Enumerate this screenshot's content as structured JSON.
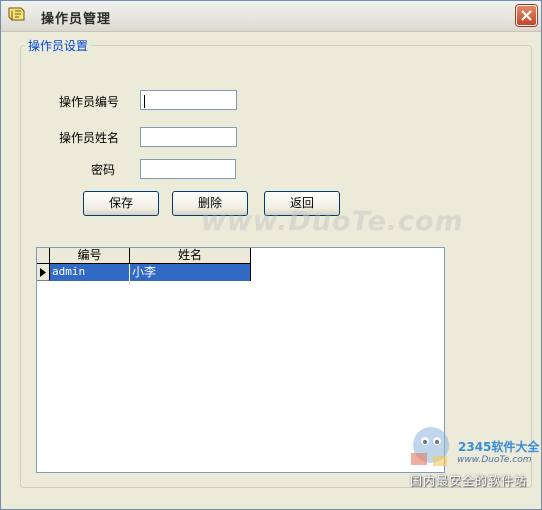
{
  "window": {
    "title": "操作员管理",
    "close_label": "×"
  },
  "group": {
    "legend": "操作员设置"
  },
  "form": {
    "operator_id_label": "操作员编号",
    "operator_id_value": "",
    "operator_name_label": "操作员姓名",
    "operator_name_value": "",
    "password_label": "密码",
    "password_value": ""
  },
  "buttons": {
    "save": "保存",
    "delete": "删除",
    "back": "返回"
  },
  "grid": {
    "columns": [
      "编号",
      "姓名"
    ],
    "rows": [
      {
        "id": "admin",
        "name": "小李"
      }
    ]
  },
  "watermarks": {
    "duote": "www.DuoTe.com",
    "brand": "2345软件大全",
    "url": "www.DuoTe.com",
    "slogan": "国内最安全的软件站"
  },
  "colors": {
    "selection": "#316ac5",
    "group_legend": "#0046d5",
    "window_bg": "#ecead9"
  }
}
